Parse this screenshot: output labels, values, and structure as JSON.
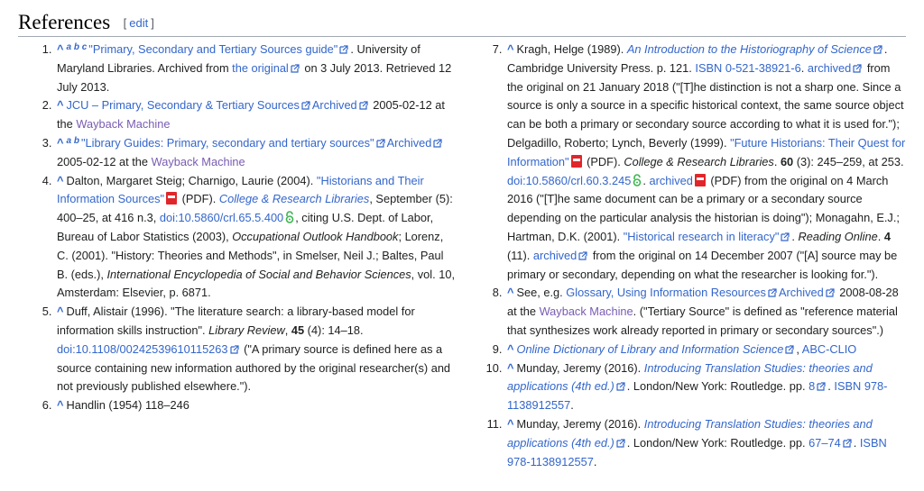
{
  "heading": {
    "title": "References",
    "edit_open": "[",
    "edit": "edit",
    "edit_close": "]"
  },
  "refs": [
    {
      "n": "1.",
      "backlinks": "a b c",
      "p1": "\"Primary, Secondary and Tertiary Sources guide\"",
      "t1": ". University of Maryland Libraries. Archived from ",
      "p2": "the original",
      "t2": " on 3 July 2013. Retrieved 12 July 2013."
    },
    {
      "n": "2.",
      "p1": "JCU – Primary, Secondary & Tertiary Sources",
      "p2": "Archived",
      "t1": " 2005-02-12 at the ",
      "wayback": "Wayback Machine"
    },
    {
      "n": "3.",
      "backlinks": "a b",
      "p1": "\"Library Guides: Primary, secondary and tertiary sources\"",
      "p2": "Archived",
      "t1": " 2005-02-12 at the ",
      "wayback": "Wayback Machine"
    },
    {
      "n": "4.",
      "t1": "Dalton, Margaret Steig; Charnigo, Laurie (2004). ",
      "p1": "\"Historians and Their Information Sources\"",
      "t2": " (PDF). ",
      "journal": "College & Research Libraries",
      "t3": ", September (5): 400–25, at 416 n.3, ",
      "doi": "doi:10.5860/crl.65.5.400",
      "t4": ", citing U.S. Dept. of Labor, Bureau of Labor Statistics (2003), ",
      "i1": "Occupational Outlook Handbook",
      "t5": "; Lorenz, C. (2001). \"History: Theories and Methods\", in Smelser, Neil J.; Baltes, Paul B. (eds.), ",
      "i2": "International Encyclopedia of Social and Behavior Sciences",
      "t6": ", vol. 10, Amsterdam: Elsevier, p. 6871."
    },
    {
      "n": "5.",
      "t1": "Duff, Alistair (1996). \"The literature search: a library-based model for information skills instruction\". ",
      "i1": "Library Review",
      "t2": ", ",
      "b1": "45",
      "t3": " (4): 14–18. ",
      "doi": "doi:10.1108/00242539610115263",
      "t4": " (\"A primary source is defined here as a source containing new information authored by the original researcher(s) and not previously published elsewhere.\")."
    },
    {
      "n": "6.",
      "t1": "Handlin (1954) 118–246"
    },
    {
      "n": "7.",
      "t1": "Kragh, Helge (1989). ",
      "p1": "An Introduction to the Historiography of Science",
      "t2": ". Cambridge University Press. p. 121. ",
      "isbn": "ISBN 0-521-38921-6",
      "t3": ". ",
      "p2": "archived",
      "t4": " from the original on 21 January 2018 (\"[T]he distinction is not a sharp one. Since a source is only a source in a specific historical context, the same source object can be both a primary or secondary source according to what it is used for.\"); Delgadillo, Roberto; Lynch, Beverly (1999). ",
      "p3": "\"Future Historians: Their Quest for Information\"",
      "t5": " (PDF). ",
      "journal": "College & Research Libraries",
      "t6": ". ",
      "b1": "60",
      "t7": " (3): 245–259, at 253. ",
      "doi": "doi:10.5860/crl.60.3.245",
      "t8": ". ",
      "p4": "archived",
      "t9": " (PDF) from the original on 4 March 2016 (\"[T]he same document can be a primary or a secondary source depending on the particular analysis the historian is doing\"); Monagahn, E.J.; Hartman, D.K. (2001). ",
      "p5": "\"Historical research in literacy\"",
      "t10": ". ",
      "i1": "Reading Online",
      "t11": ". ",
      "b2": "4",
      "t12": " (11). ",
      "p6": "archived",
      "t13": " from the original on 14 December 2007 (\"[A] source may be primary or secondary, depending on what the researcher is looking for.\")."
    },
    {
      "n": "8.",
      "t1": "See, e.g. ",
      "p1": "Glossary, Using Information Resources",
      "p2": "Archived",
      "t2": " 2008-08-28 at the ",
      "wayback": "Wayback Machine",
      "t3": ". (\"Tertiary Source\" is defined as \"reference material that synthesizes work already reported in primary or secondary sources\".)"
    },
    {
      "n": "9.",
      "p1": "Online Dictionary of Library and Information Science",
      "t1": ", ",
      "p2": "ABC-CLIO"
    },
    {
      "n": "10.",
      "t1": "Munday, Jeremy (2016). ",
      "p1": "Introducing Translation Studies: theories and applications (4th ed.)",
      "t2": ". London/New York: Routledge. pp. ",
      "p2": "8",
      "t3": ". ",
      "isbn": "ISBN 978-1138912557",
      "t4": "."
    },
    {
      "n": "11.",
      "t1": "Munday, Jeremy (2016). ",
      "p1": "Introducing Translation Studies: theories and applications (4th ed.)",
      "t2": ". London/New York: Routledge. pp. ",
      "p2": "67–74",
      "t3": ". ",
      "isbn": "ISBN 978-1138912557",
      "t4": "."
    }
  ],
  "icons": {
    "external": "external-link-icon",
    "pdf": "pdf-icon",
    "open_access": "open-access-lock-icon",
    "caret": "^"
  },
  "colors": {
    "link": "#3366cc",
    "visited": "#795cb2",
    "text": "#202122",
    "pdf": "#e0262b",
    "open_access": "#3cb550"
  }
}
